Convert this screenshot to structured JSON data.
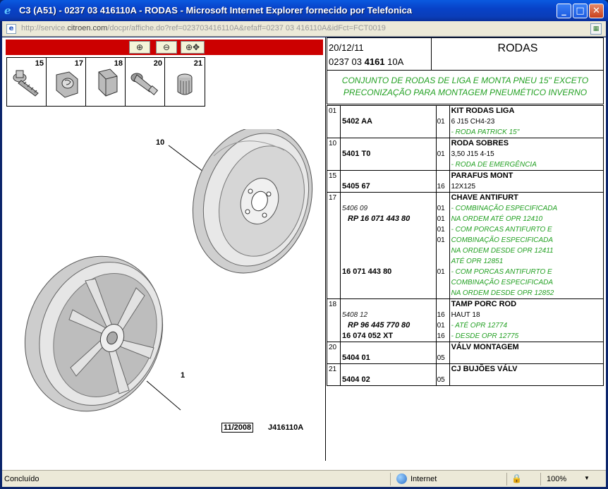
{
  "window": {
    "title": "C3 (A51) - 0237 03 416110A - RODAS - Microsoft Internet Explorer fornecido por Telefonica",
    "minimize": "_",
    "maximize": "□",
    "close": "✕"
  },
  "address": {
    "prefix": "http://service.",
    "domain": "citroen.com",
    "rest": "/docpr/affiche.do?ref=023703416110A&refaff=0237 03 416110A&idFct=FCT0019"
  },
  "toolbar": {
    "zoom_in": "⊕",
    "zoom_out": "⊖",
    "zoom_pan": "⊕✥"
  },
  "parts_strip": [
    "15",
    "17",
    "18",
    "20",
    "21"
  ],
  "figure": {
    "callout_10": "10",
    "callout_1": "1",
    "date": "11/2008",
    "ref": "J416110A"
  },
  "header": {
    "date": "20/12/11",
    "code_prefix": "0237 03 ",
    "code_bold": "4161",
    "code_suffix": " 10A",
    "title": "RODAS"
  },
  "description": {
    "line1": "CONJUNTO DE RODAS DE LIGA E MONTA PNEU 15\" EXCETO",
    "line2": "PRECONIZAÇÃO PARA MONTAGEM PNEUMÉTICO INVERNO"
  },
  "rows": [
    {
      "item": "01",
      "refs": [
        {
          "text": "",
          "cls": "ref-main"
        },
        {
          "text": "5402 AA",
          "cls": "ref-main"
        }
      ],
      "qty": [
        "",
        "01"
      ],
      "desc": [
        {
          "text": "KIT RODAS LIGA",
          "cls": "desc-title"
        },
        {
          "text": "6 J15 CH4-23",
          "cls": "desc-plain"
        },
        {
          "text": "- RODA PATRICK 15\"",
          "cls": "desc-green"
        }
      ]
    },
    {
      "item": "10",
      "refs": [
        {
          "text": "",
          "cls": "ref-main"
        },
        {
          "text": "5401 T0",
          "cls": "ref-main"
        }
      ],
      "qty": [
        "",
        "01"
      ],
      "desc": [
        {
          "text": "RODA SOBRES",
          "cls": "desc-title"
        },
        {
          "text": "3,50 J15 4-15",
          "cls": "desc-plain"
        },
        {
          "text": "- RODA DE EMERGÊNCIA",
          "cls": "desc-green"
        }
      ]
    },
    {
      "item": "15",
      "refs": [
        {
          "text": "",
          "cls": "ref-main"
        },
        {
          "text": "5405 67",
          "cls": "ref-main"
        }
      ],
      "qty": [
        "",
        "16"
      ],
      "desc": [
        {
          "text": "PARAFUS MONT",
          "cls": "desc-title"
        },
        {
          "text": "12X125",
          "cls": "desc-plain"
        }
      ]
    },
    {
      "item": "17",
      "refs": [
        {
          "text": "",
          "cls": "ref-main"
        },
        {
          "text": "5406 09",
          "cls": "ref-sub"
        },
        {
          "text": "RP 16 071 443 80",
          "cls": "ref-rp"
        },
        {
          "text": "",
          "cls": "ref-main"
        },
        {
          "text": "",
          "cls": "ref-main"
        },
        {
          "text": "",
          "cls": "ref-main"
        },
        {
          "text": "",
          "cls": "ref-main"
        },
        {
          "text": "16 071 443 80",
          "cls": "ref-main"
        },
        {
          "text": "",
          "cls": "ref-main"
        },
        {
          "text": "",
          "cls": "ref-main"
        }
      ],
      "qty": [
        "",
        "01",
        "01",
        "01",
        "01",
        "",
        "",
        "01",
        "",
        ""
      ],
      "desc": [
        {
          "text": "CHAVE ANTIFURT",
          "cls": "desc-title"
        },
        {
          "text": "- COMBINAÇÃO ESPECIFICADA",
          "cls": "desc-green"
        },
        {
          "text": "NA ORDEM ATÉ OPR 12410",
          "cls": "desc-green"
        },
        {
          "text": "- COM PORCAS ANTIFURTO E",
          "cls": "desc-green"
        },
        {
          "text": "COMBINAÇÃO ESPECIFICADA",
          "cls": "desc-green"
        },
        {
          "text": "NA ORDEM DESDE OPR 12411",
          "cls": "desc-green"
        },
        {
          "text": "ATÉ OPR 12851",
          "cls": "desc-green"
        },
        {
          "text": "- COM PORCAS ANTIFURTO E",
          "cls": "desc-green"
        },
        {
          "text": "COMBINAÇÃO ESPECIFICADA",
          "cls": "desc-green"
        },
        {
          "text": "NA ORDEM DESDE OPR 12852",
          "cls": "desc-green"
        }
      ]
    },
    {
      "item": "18",
      "refs": [
        {
          "text": "",
          "cls": "ref-main"
        },
        {
          "text": "5408 12",
          "cls": "ref-sub"
        },
        {
          "text": "RP 96 445 770 80",
          "cls": "ref-rp"
        },
        {
          "text": "16 074 052 XT",
          "cls": "ref-main"
        }
      ],
      "qty": [
        "",
        "16",
        "01",
        "16"
      ],
      "desc": [
        {
          "text": "TAMP PORC ROD",
          "cls": "desc-title"
        },
        {
          "text": "HAUT 18",
          "cls": "desc-plain"
        },
        {
          "text": "- ATÉ OPR 12774",
          "cls": "desc-green"
        },
        {
          "text": "- DESDE OPR 12775",
          "cls": "desc-green"
        }
      ]
    },
    {
      "item": "20",
      "refs": [
        {
          "text": "",
          "cls": "ref-main"
        },
        {
          "text": "5404 01",
          "cls": "ref-main"
        }
      ],
      "qty": [
        "",
        "05"
      ],
      "desc": [
        {
          "text": "VÁLV MONTAGEM",
          "cls": "desc-title"
        }
      ]
    },
    {
      "item": "21",
      "refs": [
        {
          "text": "",
          "cls": "ref-main"
        },
        {
          "text": "5404 02",
          "cls": "ref-main"
        }
      ],
      "qty": [
        "",
        "05"
      ],
      "desc": [
        {
          "text": "CJ BUJÕES VÁLV",
          "cls": "desc-title"
        }
      ]
    }
  ],
  "status": {
    "text": "Concluído",
    "zone": "Internet",
    "zoom": "100%",
    "zoom_arrow": "▼",
    "lock": "🔒"
  }
}
